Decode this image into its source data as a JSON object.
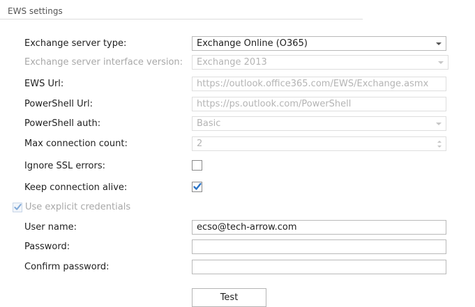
{
  "section": {
    "title": "EWS settings"
  },
  "fields": {
    "server_type": {
      "label": "Exchange server type:",
      "value": "Exchange Online (O365)"
    },
    "interface_version": {
      "label": "Exchange server interface version:",
      "value": "Exchange 2013"
    },
    "ews_url": {
      "label": "EWS Url:",
      "value": "https://outlook.office365.com/EWS/Exchange.asmx"
    },
    "powershell_url": {
      "label": "PowerShell Url:",
      "value": "https://ps.outlook.com/PowerShell"
    },
    "powershell_auth": {
      "label": "PowerShell auth:",
      "value": "Basic"
    },
    "max_connection": {
      "label": "Max connection count:",
      "value": "2"
    },
    "ignore_ssl": {
      "label": "Ignore SSL errors:",
      "checked": false
    },
    "keep_alive": {
      "label": "Keep connection alive:",
      "checked": true
    },
    "explicit_credentials": {
      "label": "Use explicit credentials",
      "checked": true
    },
    "user_name": {
      "label": "User name:",
      "value": "ecso@tech-arrow.com"
    },
    "password": {
      "label": "Password:",
      "value": ""
    },
    "confirm_password": {
      "label": "Confirm password:",
      "value": ""
    }
  },
  "test_button": {
    "label": "Test"
  },
  "colors": {
    "check_blue": "#2b74c7",
    "disabled_text": "#a8a8a8"
  }
}
